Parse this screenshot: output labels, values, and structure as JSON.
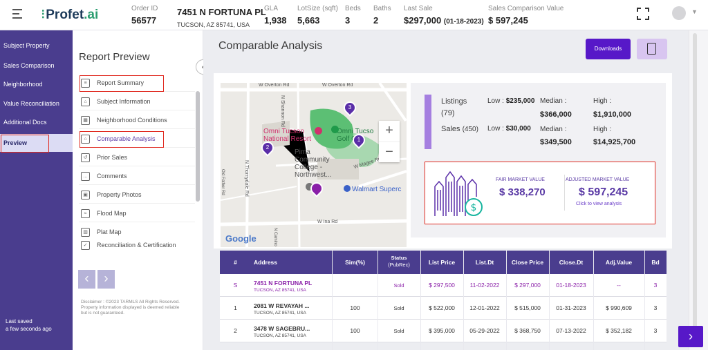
{
  "app": {
    "logo": "Profet.ai",
    "logo_main": "Profet",
    "logo_suffix": ".ai"
  },
  "header": {
    "order_label": "Order ID",
    "order_value": "56577",
    "address_line1": "7451 N FORTUNA PL",
    "address_line2": "TUCSON, AZ 85741, USA",
    "gla_label": "GLA",
    "gla_value": "1,938",
    "lot_label": "LotSize (sqft)",
    "lot_value": "5,663",
    "beds_label": "Beds",
    "beds_value": "3",
    "baths_label": "Baths",
    "baths_value": "2",
    "last_sale_label": "Last Sale",
    "last_sale_value": "$297,000",
    "last_sale_date": "(01-18-2023)",
    "scv_label": "Sales Comparison Value",
    "scv_value": "$ 597,245"
  },
  "sidebar": {
    "items": [
      {
        "label": "Subject Property"
      },
      {
        "label": "Sales Comparison"
      },
      {
        "label": "Neighborhood"
      },
      {
        "label": "Value Reconciliation"
      },
      {
        "label": "Additional Docs"
      },
      {
        "label": "Preview"
      }
    ],
    "last_saved_1": "Last saved",
    "last_saved_2": "a few seconds ago"
  },
  "report": {
    "title": "Report Preview",
    "items": [
      {
        "label": "Report Summary"
      },
      {
        "label": "Subject Information"
      },
      {
        "label": "Neighborhood Conditions"
      },
      {
        "label": "Comparable Analysis"
      },
      {
        "label": "Prior Sales"
      },
      {
        "label": "Comments"
      },
      {
        "label": "Property Photos"
      },
      {
        "label": "Flood Map"
      },
      {
        "label": "Plat Map"
      },
      {
        "label": "Reconciliation & Certification"
      }
    ],
    "disclaimer": "Disclaimer : ©2023 TARMLS All Rights Reserved. Property information displayed is deemed reliable but is not guaranteed."
  },
  "main": {
    "title": "Comparable Analysis",
    "downloads_label": "Downloads"
  },
  "map": {
    "labels": {
      "overton1": "W Overton Rd",
      "overton2": "W Overton Rd",
      "shannon": "N Shannon Rd",
      "thornydale": "N Thornydale Rd",
      "oldfarm": "Old Father Rd",
      "magee": "W Magee Rd",
      "ina": "W Ina Rd",
      "camino": "N Camino",
      "resort1": "Omni Tucson",
      "resort2": "National Resort",
      "golf1": "Omni Tucso",
      "golf2": "Golf Co",
      "pima1": "Pima",
      "pima2": "Community",
      "pima3": "College -",
      "pima4": "Northwest...",
      "walmart": "Walmart Superc",
      "google": "Google",
      "zoom_in": "+",
      "zoom_out": "−"
    },
    "pins": [
      "3",
      "1",
      "2"
    ]
  },
  "stats": {
    "listings_label": "Listings",
    "listings_count": "(79)",
    "listings_low_label": "Low :",
    "listings_low": "$235,000",
    "listings_median_label": "Median :",
    "listings_median": "$366,000",
    "listings_high_label": "High :",
    "listings_high": "$1,910,000",
    "sales_label": "Sales",
    "sales_count": "(450)",
    "sales_low_label": "Low :",
    "sales_low": "$30,000",
    "sales_median_label": "Median :",
    "sales_median": "$349,500",
    "sales_high_label": "High :",
    "sales_high": "$14,925,700",
    "fmv_label": "FAIR MARKET VALUE",
    "fmv_value": "$ 338,270",
    "amv_label": "ADJUSTED MARKET VALUE",
    "amv_value": "$ 597,245",
    "click_label": "Click to view analysis"
  },
  "table": {
    "headers": [
      "#",
      "Address",
      "Sim(%)",
      "Status",
      "(PubRec)",
      "List Price",
      "List.Dt",
      "Close Price",
      "Close.Dt",
      "Adj.Value",
      "Bd"
    ],
    "rows": [
      {
        "idx": "S",
        "addr1": "7451 N FORTUNA PL",
        "addr2": "TUCSON, AZ 85741, USA",
        "sim": "",
        "status": "Sold",
        "list_price": "$ 297,500",
        "list_dt": "11-02-2022",
        "close_price": "$ 297,000",
        "close_dt": "01-18-2023",
        "adj": "--",
        "bd": "3"
      },
      {
        "idx": "1",
        "addr1": "2081 W REVAYAH ...",
        "addr2": "TUCSON, AZ 85741, USA",
        "sim": "100",
        "status": "Sold",
        "list_price": "$ 522,000",
        "list_dt": "12-01-2022",
        "close_price": "$ 515,000",
        "close_dt": "01-31-2023",
        "adj": "$ 990,609",
        "bd": "3"
      },
      {
        "idx": "2",
        "addr1": "3478 W SAGEBRU...",
        "addr2": "TUCSON, AZ 85741, USA",
        "sim": "100",
        "status": "Sold",
        "list_price": "$ 395,000",
        "list_dt": "05-29-2022",
        "close_price": "$ 368,750",
        "close_dt": "07-13-2022",
        "adj": "$ 352,182",
        "bd": "3"
      }
    ]
  },
  "colors": {
    "brand": "#4a3d8e",
    "accent": "#5718c8",
    "highlight": "#e0291f",
    "subject_row": "#8a1fa8"
  },
  "icons": {
    "menu": "hamburger-icon",
    "expand": "fullscreen-icon",
    "user": "avatar-icon",
    "calc": "calculator-icon",
    "next": "chevron-right-icon"
  }
}
